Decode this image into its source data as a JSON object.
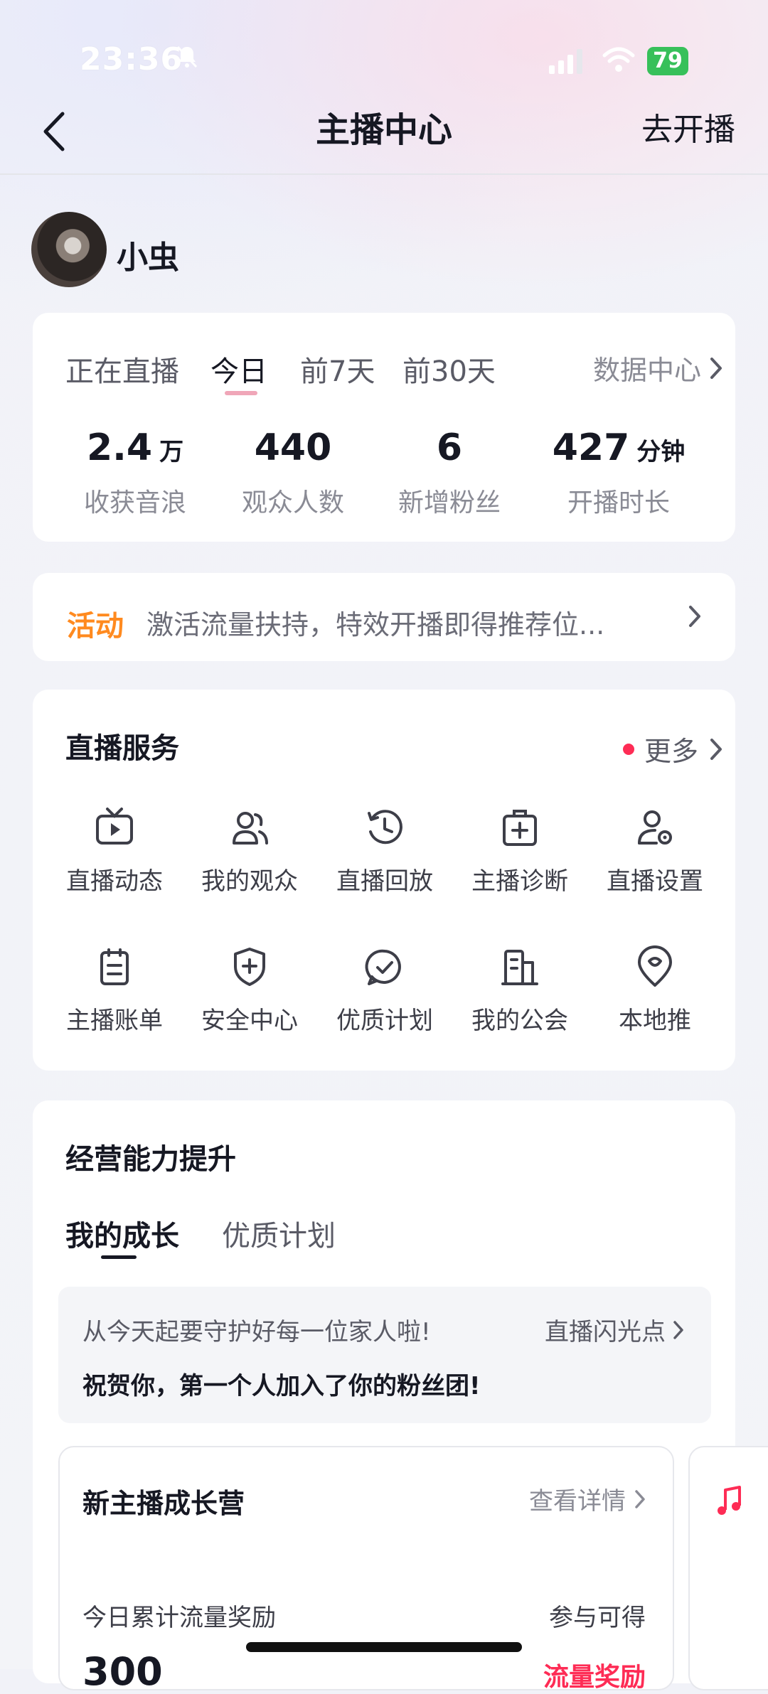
{
  "status_bar": {
    "time": "23:36",
    "battery": "79"
  },
  "nav": {
    "title": "主播中心",
    "action": "去开播"
  },
  "profile": {
    "name": "小虫"
  },
  "stats": {
    "tabs": [
      "正在直播",
      "今日",
      "前7天",
      "前30天"
    ],
    "active_tab": "今日",
    "data_center": "数据中心",
    "items": [
      {
        "value": "2.4",
        "unit": "万",
        "label": "收获音浪"
      },
      {
        "value": "440",
        "unit": "",
        "label": "观众人数"
      },
      {
        "value": "6",
        "unit": "",
        "label": "新增粉丝"
      },
      {
        "value": "427",
        "unit": "分钟",
        "label": "开播时长"
      }
    ]
  },
  "activity": {
    "tag": "活动",
    "text": "激活流量扶持，特效开播即得推荐位..."
  },
  "live_service": {
    "title": "直播服务",
    "more": "更多",
    "items": [
      {
        "label": "直播动态",
        "icon": "tv-play-icon"
      },
      {
        "label": "我的观众",
        "icon": "users-icon"
      },
      {
        "label": "直播回放",
        "icon": "history-clock-icon"
      },
      {
        "label": "主播诊断",
        "icon": "medical-kit-icon"
      },
      {
        "label": "直播设置",
        "icon": "user-settings-icon"
      },
      {
        "label": "主播账单",
        "icon": "clipboard-bill-icon"
      },
      {
        "label": "安全中心",
        "icon": "shield-plus-icon"
      },
      {
        "label": "优质计划",
        "icon": "check-bubble-icon"
      },
      {
        "label": "我的公会",
        "icon": "building-icon"
      },
      {
        "label": "本地推",
        "icon": "location-pin-icon"
      }
    ]
  },
  "growth": {
    "title": "经营能力提升",
    "tabs": [
      "我的成长",
      "优质计划"
    ],
    "notice_line1": "从今天起要守护好每一位家人啦!",
    "notice_link": "直播闪光点",
    "notice_line2": "祝贺你，第一个人加入了你的粉丝团!",
    "camp": {
      "title": "新主播成长营",
      "link": "查看详情",
      "reward_label": "今日累计流量奖励",
      "join": "参与可得",
      "amount": "300",
      "reward_name": "流量奖励"
    }
  }
}
